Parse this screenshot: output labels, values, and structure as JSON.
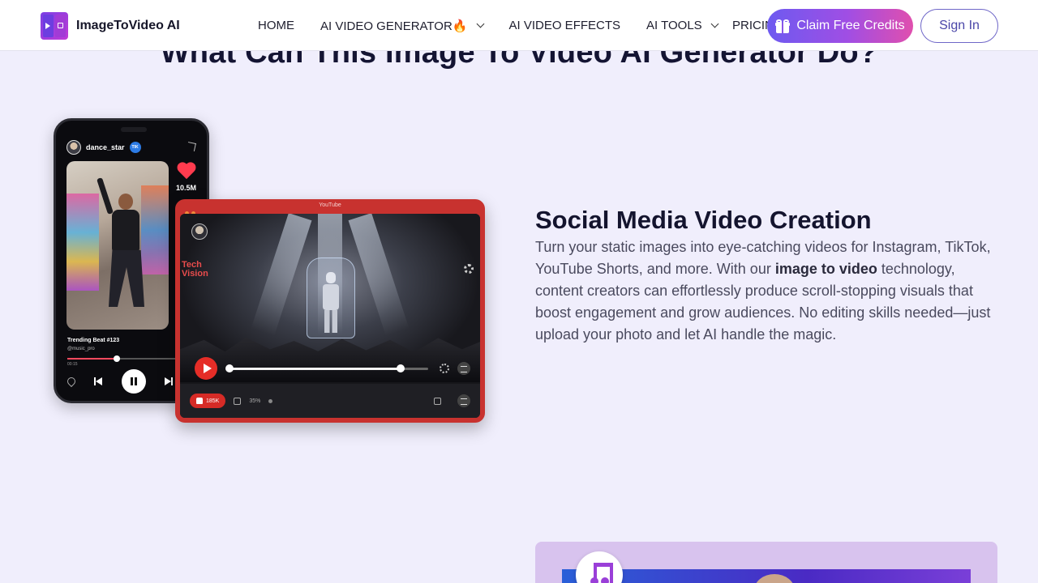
{
  "header": {
    "logo_text": "ImageToVideo AI",
    "nav": [
      {
        "label": "HOME",
        "has_dropdown": false
      },
      {
        "label": "AI VIDEO GENERATOR🔥",
        "has_dropdown": true
      },
      {
        "label": "AI VIDEO EFFECTS",
        "has_dropdown": false
      },
      {
        "label": "AI TOOLS",
        "has_dropdown": true
      },
      {
        "label": "PRICING",
        "has_dropdown": false
      }
    ],
    "claim_button": "Claim Free Credits",
    "signin_button": "Sign In"
  },
  "section": {
    "heading": "What Can This Image To Video AI Generator Do?"
  },
  "feature": {
    "title": "Social Media Video Creation",
    "desc_before": "Turn your static images into eye-catching videos for Instagram, TikTok, YouTube Shorts, and more. With our ",
    "desc_bold": "image to video",
    "desc_after": " technology, content creators can effortlessly produce scroll-stopping visuals that boost engagement and grow audiences. No editing skills needed—just upload your photo and let AI handle the magic."
  },
  "illustration": {
    "phone": {
      "username": "dance_star",
      "badge": "TIK",
      "likes": "10.5M",
      "track_title": "Trending Beat #123",
      "track_artist": "@music_pro",
      "time": "00:15",
      "progress": 0.4
    },
    "tablet": {
      "label": "YouTube",
      "sign_line1": "Tech",
      "sign_line2": "Vision",
      "likes": "185K",
      "percent": "35%",
      "progress": 0.85
    }
  },
  "colors": {
    "background": "#f0eefc",
    "accent_start": "#6d5af0",
    "accent_end": "#e04fae",
    "tablet_red": "#c8322f"
  }
}
